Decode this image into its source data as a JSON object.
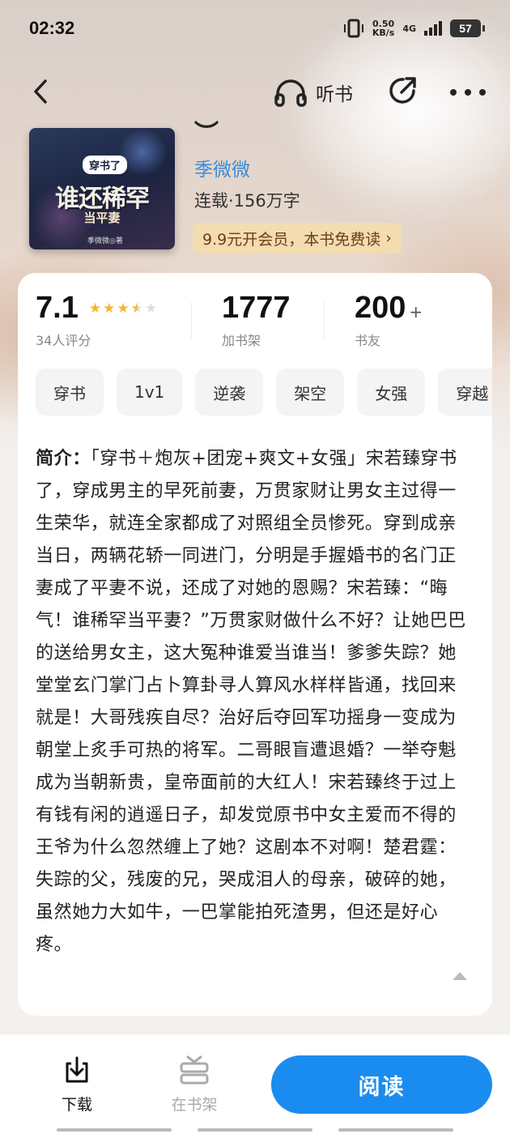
{
  "status_bar": {
    "time": "02:32",
    "speed_value": "0.50",
    "speed_unit": "KB/s",
    "network": "4G",
    "battery": "57"
  },
  "nav": {
    "listen_label": "听书"
  },
  "book": {
    "cover": {
      "tag": "穿书了",
      "title": "谁还稀罕",
      "subtitle": "当平妻",
      "author": "季微微◎著"
    },
    "title_fragment": "︶",
    "author": "季微微",
    "meta": "连载·156万字",
    "vip_banner": "9.9元开会员，本书免费读",
    "vip_arrow": "›"
  },
  "stats": {
    "rating": "7.1",
    "rating_stars": 3.5,
    "rating_label": "34人评分",
    "shelf_count": "1777",
    "shelf_label": "加书架",
    "friends_count": "200",
    "friends_plus": "+",
    "friends_label": "书友"
  },
  "tags": [
    "穿书",
    "1v1",
    "逆袭",
    "架空",
    "女强",
    "穿越"
  ],
  "intro": {
    "label": "简介：",
    "text": "「穿书＋炮灰+团宠+爽文+女强」宋若臻穿书了，穿成男主的早死前妻，万贯家财让男女主过得一生荣华，就连全家都成了对照组全员惨死。穿到成亲当日，两辆花轿一同进门，分明是手握婚书的名门正妻成了平妻不说，还成了对她的恩赐？宋若臻：“晦气！谁稀罕当平妻？”万贯家财做什么不好？让她巴巴的送给男女主，这大冤种谁爱当谁当！爹爹失踪？她堂堂玄门掌门占卜算卦寻人算风水样样皆通，找回来就是！大哥残疾自尽？治好后夺回军功摇身一变成为朝堂上炙手可热的将军。二哥眼盲遭退婚？一举夺魁成为当朝新贵，皇帝面前的大红人！宋若臻终于过上有钱有闲的逍遥日子，却发觉原书中女主爱而不得的王爷为什么忽然缠上了她？这剧本不对啊！楚君霆：失踪的父，残废的兄，哭成泪人的母亲，破碎的她，虽然她力大如牛，一巴掌能拍死渣男，但还是好心疼。"
  },
  "bottom_bar": {
    "download_label": "下载",
    "shelf_label": "在书架",
    "read_label": "阅读"
  }
}
